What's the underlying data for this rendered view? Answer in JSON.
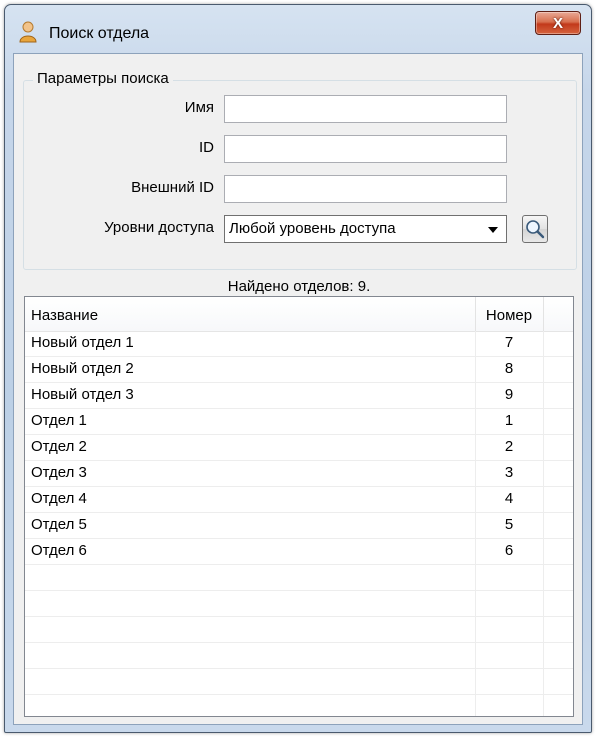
{
  "window": {
    "title": "Поиск отдела",
    "close_label": "X"
  },
  "search_params": {
    "group_title": "Параметры поиска",
    "name_label": "Имя",
    "name_value": "",
    "id_label": "ID",
    "id_value": "",
    "external_id_label": "Внешний ID",
    "external_id_value": "",
    "access_level_label": "Уровни доступа",
    "access_level_value": "Любой уровень доступа"
  },
  "results": {
    "found_text": "Найдено отделов: 9.",
    "columns": [
      "Название",
      "Номер"
    ],
    "rows": [
      {
        "name": "Новый отдел 1",
        "number": "7"
      },
      {
        "name": "Новый отдел 2",
        "number": "8"
      },
      {
        "name": "Новый отдел 3",
        "number": "9"
      },
      {
        "name": "Отдел 1",
        "number": "1"
      },
      {
        "name": "Отдел 2",
        "number": "2"
      },
      {
        "name": "Отдел 3",
        "number": "3"
      },
      {
        "name": "Отдел 4",
        "number": "4"
      },
      {
        "name": "Отдел 5",
        "number": "5"
      },
      {
        "name": "Отдел 6",
        "number": "6"
      }
    ]
  },
  "icons": {
    "title": "person-icon",
    "search": "magnifier-icon",
    "dropdown": "chevron-down-icon",
    "close": "close-icon"
  },
  "colors": {
    "close_button": "#c2391b",
    "title_bar": "#c6d6ea"
  }
}
